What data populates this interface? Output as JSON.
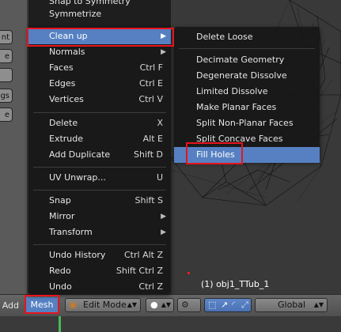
{
  "top_menu_partial": {
    "snap_symmetry": "Snap to Symmetry",
    "symmetrize": "Symmetrize"
  },
  "mesh_menu": {
    "items": [
      {
        "label": "Clean up",
        "shortcut": "",
        "submenu": true,
        "highlighted": true
      },
      {
        "label": "Normals",
        "shortcut": "",
        "submenu": true
      },
      {
        "label": "Faces",
        "shortcut": "Ctrl F",
        "submenu": true
      },
      {
        "label": "Edges",
        "shortcut": "Ctrl E",
        "submenu": true
      },
      {
        "label": "Vertices",
        "shortcut": "Ctrl V",
        "submenu": true
      },
      {
        "label": "Delete",
        "shortcut": "X",
        "submenu": true
      },
      {
        "label": "Extrude",
        "shortcut": "Alt E",
        "submenu": true
      },
      {
        "label": "Add Duplicate",
        "shortcut": "Shift D",
        "submenu": false
      },
      {
        "label": "UV Unwrap...",
        "shortcut": "U",
        "submenu": true
      },
      {
        "label": "Snap",
        "shortcut": "Shift S",
        "submenu": true
      },
      {
        "label": "Mirror",
        "shortcut": "",
        "submenu": true
      },
      {
        "label": "Transform",
        "shortcut": "",
        "submenu": true
      },
      {
        "label": "Undo History",
        "shortcut": "Ctrl Alt Z",
        "submenu": false
      },
      {
        "label": "Redo",
        "shortcut": "Shift Ctrl Z",
        "submenu": false
      },
      {
        "label": "Undo",
        "shortcut": "Ctrl Z",
        "submenu": false
      }
    ]
  },
  "cleanup_submenu": {
    "items": [
      {
        "label": "Delete Loose"
      },
      {
        "label": "Decimate Geometry"
      },
      {
        "label": "Degenerate Dissolve"
      },
      {
        "label": "Limited Dissolve"
      },
      {
        "label": "Make Planar Faces"
      },
      {
        "label": "Split Non-Planar Faces"
      },
      {
        "label": "Split Concave Faces"
      },
      {
        "label": "Fill Holes",
        "highlighted": true
      }
    ]
  },
  "viewport": {
    "object_label": "(1) obj1_TTub_1"
  },
  "header": {
    "add_label": "Add",
    "mesh_label": "Mesh",
    "mode_label": "Edit Mode",
    "orientation_label": "Global"
  },
  "toolshelf": {
    "partial_buttons": [
      "nt",
      "e",
      "",
      "gs",
      "e"
    ]
  },
  "colors": {
    "highlight": "#5680c2",
    "annotation_red": "#e8141c",
    "menu_bg": "#181818"
  }
}
